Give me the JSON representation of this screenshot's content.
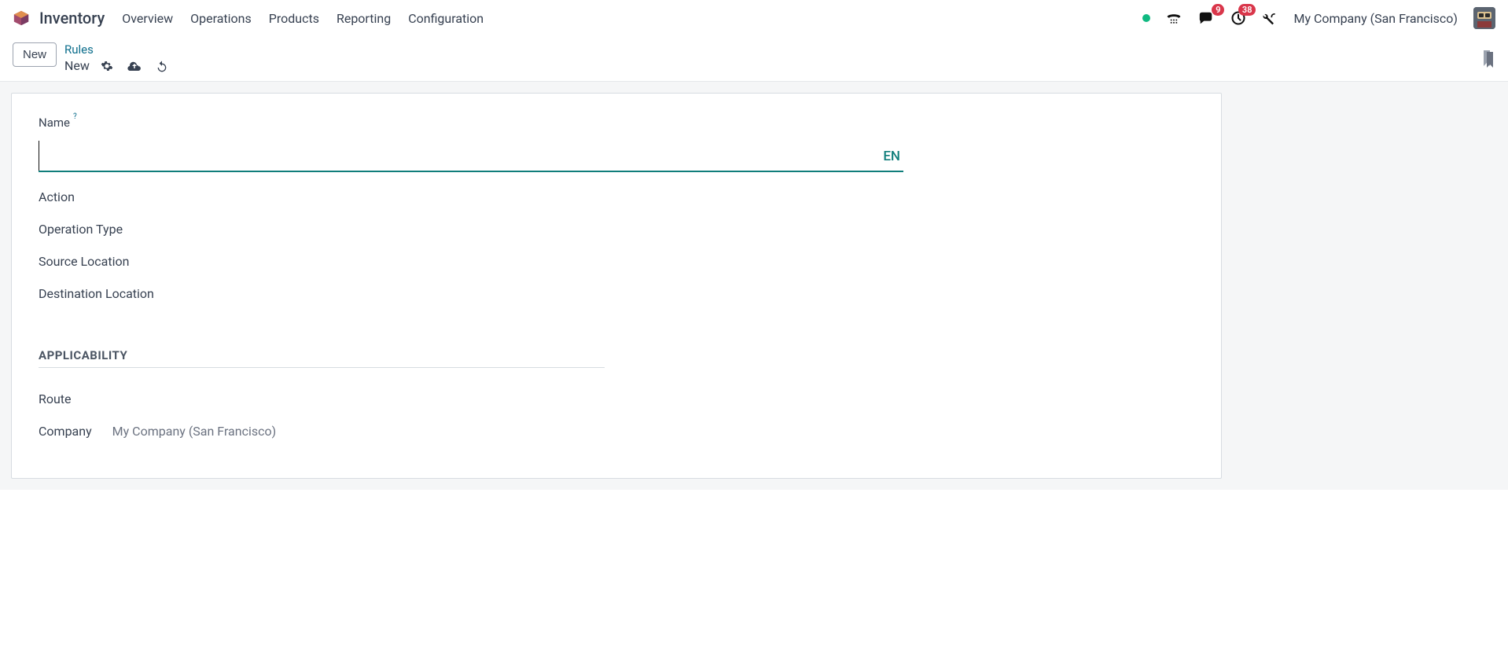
{
  "app": {
    "title": "Inventory",
    "menu": [
      "Overview",
      "Operations",
      "Products",
      "Reporting",
      "Configuration"
    ]
  },
  "header": {
    "messages_badge": "9",
    "activities_badge": "38",
    "company": "My Company (San Francisco)"
  },
  "control": {
    "new_button": "New",
    "breadcrumb_parent": "Rules",
    "breadcrumb_current": "New"
  },
  "form": {
    "name_label": "Name",
    "name_help": "?",
    "name_value": "",
    "lang_tag": "EN",
    "fields": {
      "action": "Action",
      "operation_type": "Operation Type",
      "source_location": "Source Location",
      "destination_location": "Destination Location"
    },
    "section_applicability": "APPLICABILITY",
    "applicability": {
      "route_label": "Route",
      "company_label": "Company",
      "company_value": "My Company (San Francisco)"
    }
  }
}
